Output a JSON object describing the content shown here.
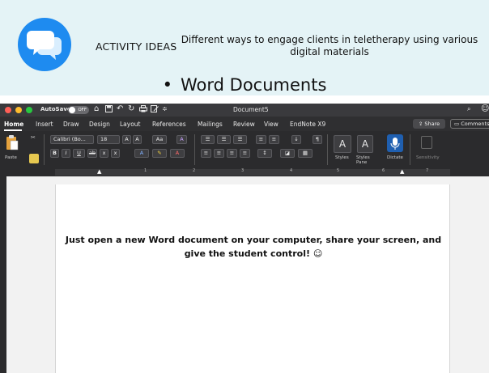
{
  "slide": {
    "label": "ACTIVITY IDEAS",
    "subtitle": "Different ways to engage clients in teletherapy using various digital materials",
    "bullet": "•",
    "heading": "Word Documents"
  },
  "word": {
    "titlebar": {
      "autosave_label": "AutoSave",
      "autosave_state": "OFF",
      "document_title": "Document5"
    },
    "menu": [
      "Home",
      "Insert",
      "Draw",
      "Design",
      "Layout",
      "References",
      "Mailings",
      "Review",
      "View",
      "EndNote X9"
    ],
    "share_label": "Share",
    "comments_label": "Comments",
    "ribbon": {
      "paste_label": "Paste",
      "font_name": "Calibri (Bo...",
      "font_size": "18",
      "styles_label": "Styles",
      "styles_pane_label": "Styles Pane",
      "dictate_label": "Dictate",
      "sensitivity_label": "Sensitivity"
    },
    "ruler_numbers": [
      "1",
      "2",
      "3",
      "4",
      "5",
      "6",
      "7"
    ],
    "page_text": "Just open a new Word document on your computer, share your screen, and give the student control! ☺"
  },
  "colors": {
    "header_bg": "#e4f3f6",
    "logo_blue": "#1e8bf0",
    "ribbon_bg": "#2b2b2d",
    "titlebar_bg": "#3a3a3d"
  }
}
